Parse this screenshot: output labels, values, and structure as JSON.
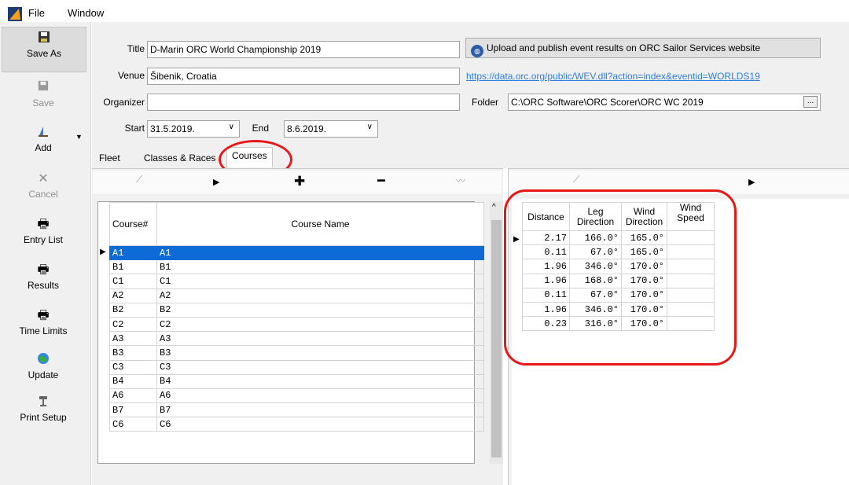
{
  "menubar": {
    "file": "File",
    "window": "Window"
  },
  "toolbar": {
    "save_as": "Save As",
    "save": "Save",
    "add": "Add",
    "cancel": "Cancel",
    "entry_list": "Entry List",
    "results": "Results",
    "time_limits": "Time Limits",
    "update": "Update",
    "print_setup": "Print Setup"
  },
  "form": {
    "title_label": "Title",
    "title_value": "D-Marin ORC World Championship 2019",
    "venue_label": "Venue",
    "venue_value": "Šibenik, Croatia",
    "organizer_label": "Organizer",
    "organizer_value": "",
    "start_label": "Start",
    "start_value": "31.5.2019.",
    "end_label": "End",
    "end_value": "8.6.2019.",
    "upload_button": "Upload and publish event results on ORC Sailor Services website",
    "event_link": "https://data.orc.org/public/WEV.dll?action=index&eventid=WORLDS19",
    "folder_label": "Folder",
    "folder_value": "C:\\ORC Software\\ORC Scorer\\ORC WC 2019",
    "browse": "..."
  },
  "tabs": [
    "Fleet",
    "Classes & Races",
    "Courses"
  ],
  "colors": {
    "highlight": "#e81818",
    "selection": "#0e6ad6",
    "link": "#2a7ee0"
  },
  "courses": {
    "headers": {
      "num": "Course#",
      "name": "Course Name"
    },
    "rows": [
      {
        "num": "A1",
        "name": "A1"
      },
      {
        "num": "B1",
        "name": "B1"
      },
      {
        "num": "C1",
        "name": "C1"
      },
      {
        "num": "A2",
        "name": "A2"
      },
      {
        "num": "B2",
        "name": "B2"
      },
      {
        "num": "C2",
        "name": "C2"
      },
      {
        "num": "A3",
        "name": "A3"
      },
      {
        "num": "B3",
        "name": "B3"
      },
      {
        "num": "C3",
        "name": "C3"
      },
      {
        "num": "B4",
        "name": "B4"
      },
      {
        "num": "A6",
        "name": "A6"
      },
      {
        "num": "B7",
        "name": "B7"
      },
      {
        "num": "C6",
        "name": "C6"
      }
    ]
  },
  "legs": {
    "headers": {
      "distance": "Distance",
      "leg_a": "Leg",
      "leg_b": "Direction",
      "wind_a": "Wind",
      "wind_b": "Direction",
      "speed_a": "Wind",
      "speed_b": "Speed"
    },
    "rows": [
      {
        "distance": "2.17",
        "leg": "166.0°",
        "wind": "165.0°",
        "speed": ""
      },
      {
        "distance": "0.11",
        "leg": "67.0°",
        "wind": "165.0°",
        "speed": ""
      },
      {
        "distance": "1.96",
        "leg": "346.0°",
        "wind": "170.0°",
        "speed": ""
      },
      {
        "distance": "1.96",
        "leg": "168.0°",
        "wind": "170.0°",
        "speed": ""
      },
      {
        "distance": "0.11",
        "leg": "67.0°",
        "wind": "170.0°",
        "speed": ""
      },
      {
        "distance": "1.96",
        "leg": "346.0°",
        "wind": "170.0°",
        "speed": ""
      },
      {
        "distance": "0.23",
        "leg": "316.0°",
        "wind": "170.0°",
        "speed": ""
      }
    ]
  }
}
